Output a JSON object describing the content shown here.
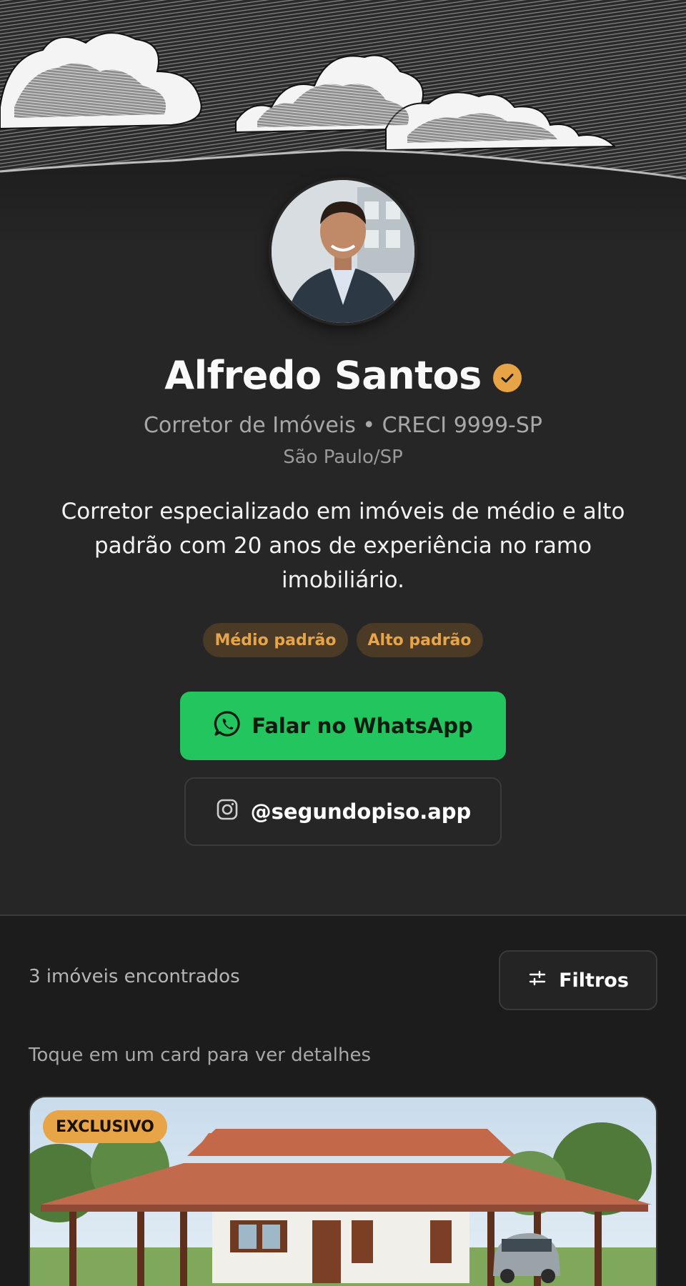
{
  "profile": {
    "name": "Alfredo Santos",
    "subtitle": "Corretor de Imóveis • CRECI 9999-SP",
    "location": "São Paulo/SP",
    "bio": "Corretor especializado em imóveis de médio e alto padrão com 20 anos de experiência no ramo imobiliário.",
    "tags": [
      "Médio padrão",
      "Alto padrão"
    ]
  },
  "actions": {
    "whatsapp_label": "Falar no WhatsApp",
    "instagram_label": "@segundopiso.app"
  },
  "listings": {
    "count_label": "3 imóveis encontrados",
    "filter_label": "Filtros",
    "hint": "Toque em um card para ver detalhes",
    "cards": [
      {
        "badge": "EXCLUSIVO"
      }
    ]
  },
  "icons": {
    "verified": "verified-check-icon",
    "whatsapp": "whatsapp-icon",
    "instagram": "instagram-icon",
    "filter": "sliders-icon"
  },
  "colors": {
    "accent": "#e8a548",
    "whatsapp_green": "#22c55e",
    "background": "#262626",
    "listing_background": "#1c1c1c"
  }
}
